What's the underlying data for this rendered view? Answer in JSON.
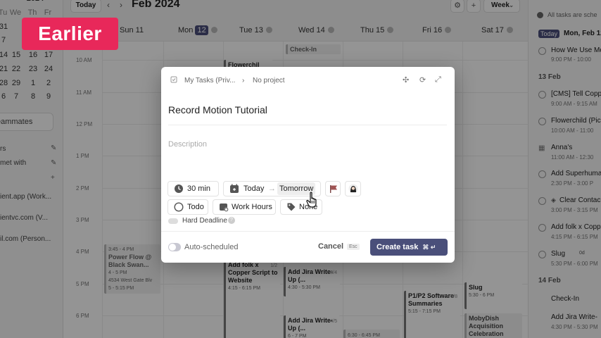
{
  "badge": {
    "label": "Earlier",
    "color": "#e8285a"
  },
  "mini_calendar": {
    "rows": [
      [
        "",
        "",
        "",
        "",
        ""
      ],
      [
        "31",
        "1",
        "2",
        "3"
      ],
      [
        "7",
        "8",
        "9",
        "10"
      ],
      [
        "14",
        "15",
        "16",
        "17"
      ],
      [
        "21",
        "22",
        "23",
        "24"
      ],
      [
        "28",
        "29",
        "1",
        "2"
      ],
      [
        "6",
        "7",
        "8",
        "9"
      ]
    ],
    "partial_title": "2024",
    "weekday_header": [
      "Tu",
      "We",
      "Th",
      "Fr",
      "Sa"
    ]
  },
  "left": {
    "teammates_label": "eammates",
    "lists": [
      "rs",
      "met with",
      "ient.app (Work...",
      "ientvc.com (V...",
      "il.com (Person..."
    ]
  },
  "topbar": {
    "today_label": "Today",
    "prev_icon": "chevron-left-icon",
    "next_icon": "chevron-right-icon",
    "month_title": "Feb 2024",
    "filter_icon": "sliders-icon",
    "add_icon": "plus-icon",
    "view_label": "Week"
  },
  "days": [
    {
      "name": "Sun",
      "num": "11"
    },
    {
      "name": "Mon",
      "num": "12",
      "current": true
    },
    {
      "name": "Tue",
      "num": "13"
    },
    {
      "name": "Wed",
      "num": "14"
    },
    {
      "name": "Thu",
      "num": "15"
    },
    {
      "name": "Fri",
      "num": "16"
    },
    {
      "name": "Sat",
      "num": "17"
    }
  ],
  "hours": [
    "10 AM",
    "11 AM",
    "12 PM",
    "1 PM",
    "2 PM",
    "3 PM",
    "4 PM",
    "5 PM",
    "6 PM"
  ],
  "events": {
    "flowerchild": "Flowerchil",
    "checkin": "Check-In",
    "power_flow": {
      "time": "3:45 - 4 PM",
      "title": "Power Flow @ Black Swan...",
      "time2": "4 - 5 PM",
      "loc": "4534 West Gate Blv",
      "time3": "5 - 5:15 PM"
    },
    "folk": {
      "title": "Add folk x Copper Script to Website",
      "time": "4:15 - 6:15 PM",
      "frac": "1/2"
    },
    "jira1": {
      "title": "Add Jira Write-Up (...",
      "time": "4:30 - 5:30 PM",
      "frac": "3/4"
    },
    "jira2": {
      "title": "Add Jira Write-Up (...",
      "time": "6 - 7 PM",
      "frac": "4/5"
    },
    "p1p2": {
      "title": "P1/P2 Software Summaries",
      "time": "5:15 - 7:15 PM",
      "frac": "5/8"
    },
    "p1p2_time2": "6:30 - 6:45 PM",
    "slug": {
      "title": "Slug",
      "time": "5:30 - 6 PM"
    },
    "mobydish": "MobyDish Acquisition Celebration"
  },
  "right": {
    "scheduled_note": "All tasks are sche",
    "today_chip": "Today",
    "today_date": "Mon, Feb 12",
    "items_top": [
      {
        "title": "How We Use Me",
        "sub": "9:00 PM - 10:00"
      }
    ],
    "section1": "13 Feb",
    "items": [
      {
        "title": "[CMS] Tell Copp",
        "sub": "9:00 AM - 9:15 AM"
      },
      {
        "title": "Flowerchild (Pic",
        "sub": "10:00 AM - 11:00"
      },
      {
        "title": "Anna's",
        "sub": "11:00 AM - 12:30"
      },
      {
        "title": "Add Superhuma",
        "sub": "2:30 PM - 3:00 P"
      },
      {
        "title": "Clear Contac",
        "sub": "3:00 PM - 3:15 PM"
      },
      {
        "title": "Add folk x Copp",
        "sub": "4:15 PM - 6:15 PM"
      },
      {
        "title": "Slug",
        "sub": "5:30 PM - 6:00 PM"
      }
    ],
    "slug_badge": "0d",
    "section2": "14 Feb",
    "items2": [
      {
        "title": "Check-In",
        "sub": ""
      },
      {
        "title": "Add Jira Write-",
        "sub": "4:30 PM - 5:30 PM"
      }
    ]
  },
  "modal": {
    "breadcrumb_workspace": "My Tasks (Priv...",
    "breadcrumb_project": "No project",
    "title": "Record Motion Tutorial",
    "description_placeholder": "Description",
    "duration": "30 min",
    "start": "Today",
    "arrow": "→",
    "deadline": "Tomorrow",
    "status": "Todo",
    "schedule": "Work Hours",
    "labels": "None",
    "hard_deadline": "Hard Deadline",
    "help": "?",
    "auto_scheduled": "Auto-scheduled",
    "cancel": "Cancel",
    "esc_key": "Esc",
    "create": "Create task",
    "create_shortcut": "⌘ ↵"
  },
  "colors": {
    "accent": "#4a4f7a",
    "flag": "#a05454"
  }
}
